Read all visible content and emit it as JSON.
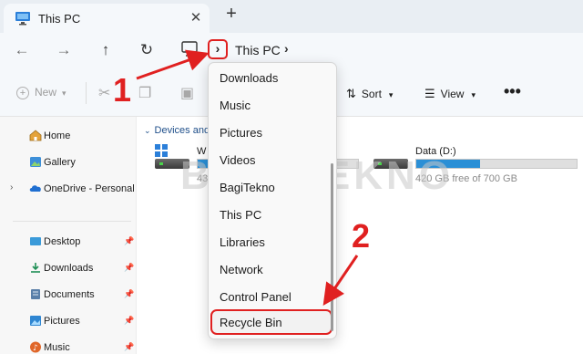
{
  "tab": {
    "title": "This PC",
    "close_glyph": "✕",
    "new_tab_glyph": "+"
  },
  "nav": {
    "back_glyph": "←",
    "forward_glyph": "→",
    "up_glyph": "↑",
    "refresh_glyph": "↻",
    "breadcrumb_separator_glyph": "›",
    "breadcrumb": [
      "This PC"
    ]
  },
  "toolbar": {
    "new_label": "New",
    "sort_label": "Sort",
    "view_label": "View",
    "more_glyph": "•••"
  },
  "sidebar": {
    "items": [
      {
        "label": "Home",
        "icon": "home-icon",
        "pinned": false
      },
      {
        "label": "Gallery",
        "icon": "gallery-icon",
        "pinned": false
      },
      {
        "label": "OneDrive - Personal",
        "icon": "cloud-icon",
        "pinned": false,
        "expandable": true
      },
      {
        "label": "Desktop",
        "icon": "desktop-icon",
        "pinned": true
      },
      {
        "label": "Downloads",
        "icon": "download-icon",
        "pinned": true
      },
      {
        "label": "Documents",
        "icon": "documents-icon",
        "pinned": true
      },
      {
        "label": "Pictures",
        "icon": "pictures-icon",
        "pinned": true
      },
      {
        "label": "Music",
        "icon": "music-icon",
        "pinned": true
      }
    ]
  },
  "main": {
    "section_title": "Devices and drives",
    "drives": [
      {
        "name": "W",
        "free_text": "43",
        "used_fraction": 0.42
      },
      {
        "name": "Data (D:)",
        "free_text": "420 GB free of 700 GB",
        "used_fraction": 0.4
      }
    ]
  },
  "dropdown": {
    "items": [
      "Downloads",
      "Music",
      "Pictures",
      "Videos",
      "BagiTekno",
      "This PC",
      "Libraries",
      "Network",
      "Control Panel",
      "Recycle Bin"
    ],
    "highlighted": "Recycle Bin"
  },
  "annotations": {
    "step1": "1",
    "step2": "2"
  },
  "watermark": "BAGITEKNO",
  "colors": {
    "accent": "#e02020",
    "drive_fill": "#2a8fd6",
    "section": "#1f4f8a"
  }
}
